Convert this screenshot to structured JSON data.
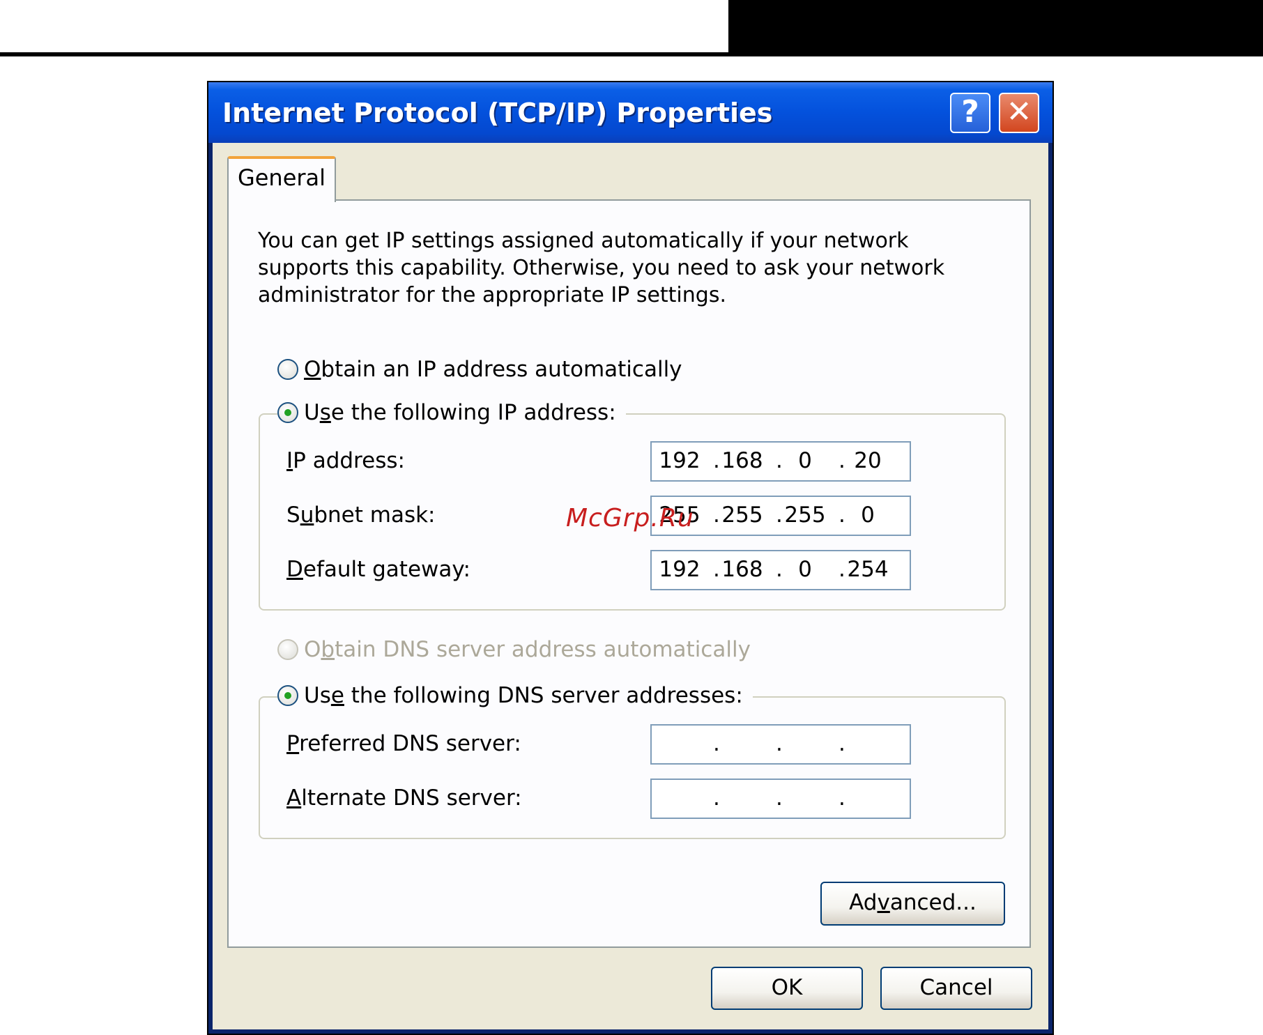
{
  "dialog": {
    "title": "Internet Protocol (TCP/IP) Properties",
    "help_label": "?",
    "close_label": "✕"
  },
  "tab": {
    "label": "General"
  },
  "description": "You can get IP settings assigned automatically if your network supports this capability. Otherwise, you need to ask your network administrator for the appropriate IP settings.",
  "ip_options": {
    "auto": {
      "pre": "",
      "key": "O",
      "post": "btain an IP address automatically",
      "selected": false
    },
    "manual": {
      "pre": "U",
      "key": "s",
      "post": "e the following IP address:",
      "selected": true
    }
  },
  "ip_fields": {
    "ip_address": {
      "pre": "",
      "key": "I",
      "post": "P address:",
      "octets": [
        "192",
        "168",
        "0",
        "20"
      ]
    },
    "subnet_mask": {
      "pre": "S",
      "key": "u",
      "post": "bnet mask:",
      "octets": [
        "255",
        "255",
        "255",
        "0"
      ]
    },
    "default_gateway": {
      "pre": "",
      "key": "D",
      "post": "efault gateway:",
      "octets": [
        "192",
        "168",
        "0",
        "254"
      ]
    }
  },
  "dns_options": {
    "auto": {
      "pre": "O",
      "key": "b",
      "post": "tain DNS server address automatically",
      "selected": false,
      "disabled": true
    },
    "manual": {
      "pre": "Us",
      "key": "e",
      "post": " the following DNS server addresses:",
      "selected": true
    }
  },
  "dns_fields": {
    "preferred": {
      "pre": "",
      "key": "P",
      "post": "referred DNS server:",
      "octets": [
        "",
        "",
        "",
        ""
      ]
    },
    "alternate": {
      "pre": "",
      "key": "A",
      "post": "lternate DNS server:",
      "octets": [
        "",
        "",
        "",
        ""
      ]
    }
  },
  "buttons": {
    "advanced": {
      "pre": "Ad",
      "key": "v",
      "post": "anced..."
    },
    "ok": "OK",
    "cancel": "Cancel"
  },
  "watermark": "McGrp.Ru"
}
